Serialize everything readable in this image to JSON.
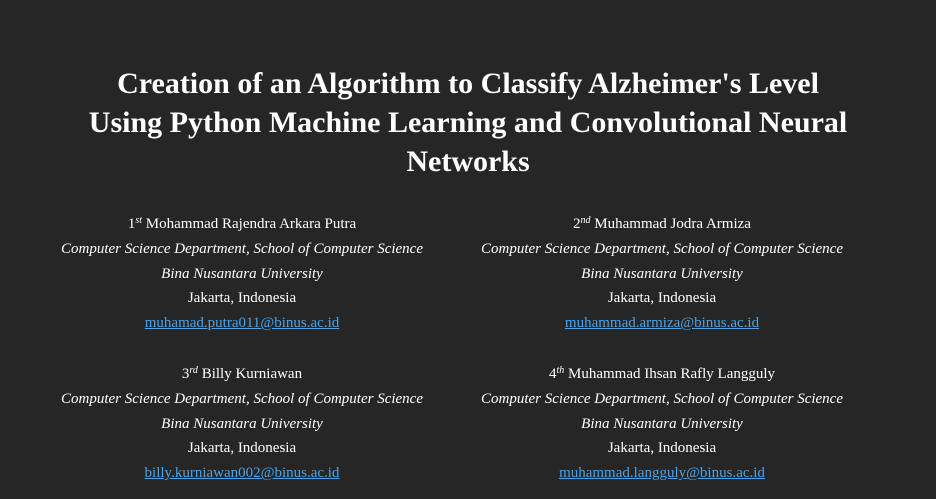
{
  "paper": {
    "title_lines": [
      "Creation of an Algorithm to Classify Alzheimer's Level",
      "Using Python Machine Learning and Convolutional Neural",
      "Networks"
    ],
    "authors": [
      {
        "ordinal": "1",
        "ordinal_suffix": "st",
        "name": "Mohammad Rajendra Arkara Putra",
        "department": "Computer Science Department, School of Computer Science",
        "university": "Bina Nusantara University",
        "location": "Jakarta, Indonesia",
        "email": "muhamad.putra011@binus.ac.id"
      },
      {
        "ordinal": "2",
        "ordinal_suffix": "nd",
        "name": "Muhammad Jodra Armiza",
        "department": "Computer Science Department, School of Computer Science",
        "university": "Bina Nusantara University",
        "location": "Jakarta, Indonesia",
        "email": "muhammad.armiza@binus.ac.id"
      },
      {
        "ordinal": "3",
        "ordinal_suffix": "rd",
        "name": "Billy Kurniawan",
        "department": "Computer Science Department, School of Computer Science",
        "university": "Bina Nusantara University",
        "location": "Jakarta, Indonesia",
        "email": "billy.kurniawan002@binus.ac.id"
      },
      {
        "ordinal": "4",
        "ordinal_suffix": "th",
        "name": "Muhammad Ihsan Rafly Langguly",
        "department": "Computer Science Department, School of Computer Science",
        "university": "Bina Nusantara University",
        "location": "Jakarta, Indonesia",
        "email": "muhammad.langguly@binus.ac.id"
      }
    ]
  },
  "colors": {
    "background": "#262626",
    "text": "#ffffff",
    "link": "#4aa3ea"
  }
}
